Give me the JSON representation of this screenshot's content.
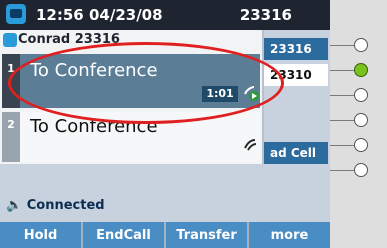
{
  "status": {
    "datetime": "12:56 04/23/08",
    "extension": "23316"
  },
  "panel": {
    "header": "Conrad 23316"
  },
  "calls": [
    {
      "index": "1",
      "title": "To Conference",
      "timer": "1:01"
    },
    {
      "index": "2",
      "title": "To Conference"
    }
  ],
  "lines": [
    {
      "label": "23316"
    },
    {
      "label": "23310"
    },
    {
      "label": "ad Cell"
    }
  ],
  "footer": {
    "status": "Connected"
  },
  "softkeys": [
    "Hold",
    "EndCall",
    "Transfer",
    "more"
  ],
  "colors": {
    "accent": "#2c6b9e",
    "active": "#7ac21c",
    "highlight": "#e02020"
  }
}
